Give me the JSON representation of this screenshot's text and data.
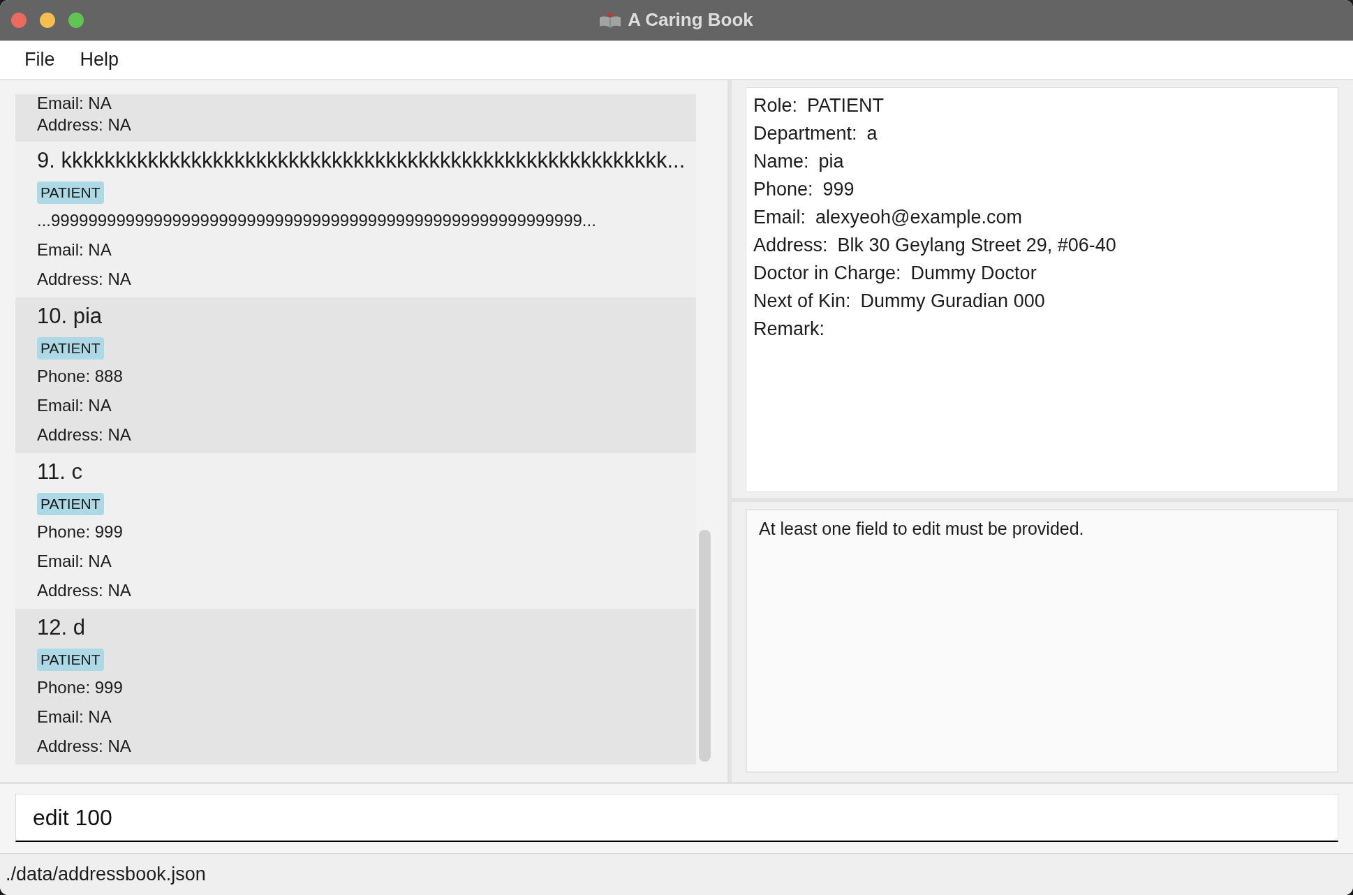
{
  "window": {
    "title": "A Caring Book"
  },
  "menu": [
    "File",
    "Help"
  ],
  "person_list": {
    "items": [
      {
        "lines": [
          "Email: NA",
          "Address: NA"
        ]
      },
      {
        "title": "9. kkkkkkkkkkkkkkkkkkkkkkkkkkkkkkkkkkkkkkkkkkkkkkkkkkkkkkkk...",
        "tags": [
          "PATIENT"
        ],
        "lines": [
          "...999999999999999999999999999999999999999999999999999999999...",
          "Email: NA",
          "Address: NA"
        ]
      },
      {
        "title": "10. pia",
        "tags": [
          "PATIENT"
        ],
        "lines": [
          "Phone: 888",
          "Email: NA",
          "Address: NA"
        ]
      },
      {
        "title": "11. c",
        "tags": [
          "PATIENT"
        ],
        "lines": [
          "Phone: 999",
          "Email: NA",
          "Address: NA"
        ]
      },
      {
        "title": "12. d",
        "tags": [
          "PATIENT"
        ],
        "lines": [
          "Phone: 999",
          "Email: NA",
          "Address: NA"
        ]
      }
    ]
  },
  "details": [
    {
      "label": "Role:",
      "value": "PATIENT"
    },
    {
      "label": "Department:",
      "value": "a"
    },
    {
      "label": "Name:",
      "value": "pia"
    },
    {
      "label": "Phone:",
      "value": "999"
    },
    {
      "label": "Email:",
      "value": "alexyeoh@example.com"
    },
    {
      "label": "Address:",
      "value": "Blk 30 Geylang Street 29, #06-40"
    },
    {
      "label": "Doctor in Charge:",
      "value": "Dummy Doctor"
    },
    {
      "label": "Next of Kin:",
      "value": "Dummy Guradian 000"
    },
    {
      "label": "Remark:"
    }
  ],
  "result": "At least one field to edit must be provided.",
  "command": {
    "value": "edit 100"
  },
  "status_bar": "./data/addressbook.json"
}
